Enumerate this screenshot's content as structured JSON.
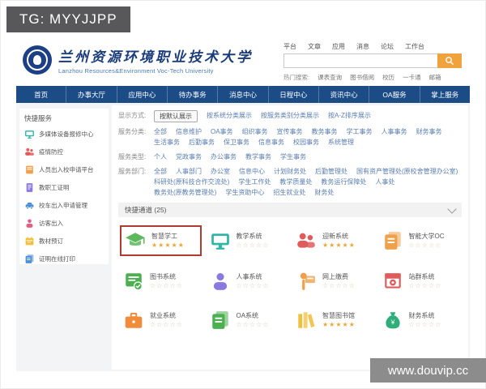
{
  "badge": {
    "text": "TG: MYYJJPP"
  },
  "watermark": {
    "text": "www.douvip.cc"
  },
  "header": {
    "university_cn": "兰州资源环境职业技术大学",
    "university_en": "Lanzhou Resources&Environment Voc-Tech University",
    "top_links": [
      "平台",
      "文章",
      "应用",
      "消息",
      "论坛",
      "工作台"
    ],
    "search": {
      "value": "",
      "placeholder": ""
    },
    "hot_links_label": "热门搜索:",
    "hot_links": [
      "课表查询",
      "图书借阅",
      "校历",
      "一卡通",
      "邮箱"
    ]
  },
  "nav": {
    "items": [
      "首页",
      "办事大厅",
      "应用中心",
      "待办事务",
      "消息中心",
      "日程中心",
      "资讯中心",
      "OA服务",
      "掌上服务"
    ]
  },
  "sidebar": {
    "title": "快捷服务",
    "items": [
      {
        "label": "多媒体设备报修中心",
        "icon": "monitor-icon",
        "color": "#2fb5a3"
      },
      {
        "label": "疫情防控",
        "icon": "people-icon",
        "color": "#e05c5c"
      },
      {
        "label": "人员出入校申请平台",
        "icon": "book-icon",
        "color": "#f0a04a"
      },
      {
        "label": "教职工证明",
        "icon": "doc-icon",
        "color": "#8a7ae0"
      },
      {
        "label": "校车出入申请管理",
        "icon": "car-icon",
        "color": "#4a90d9"
      },
      {
        "label": "访客出入",
        "icon": "person-icon",
        "color": "#e06080"
      },
      {
        "label": "教材预订",
        "icon": "calendar-icon",
        "color": "#f0c040"
      },
      {
        "label": "证明在线打印",
        "icon": "docs-icon",
        "color": "#4a90d9"
      }
    ]
  },
  "filters": [
    {
      "label": "显示方式:",
      "selected_index": 0,
      "options": [
        "按默认展示",
        "按系统分类展示",
        "按服务类别分类展示",
        "按A-Z排序展示"
      ]
    },
    {
      "label": "服务分类:",
      "selected_index": -1,
      "options": [
        "全部",
        "信息维护",
        "OA事务",
        "组织事务",
        "宣传事务",
        "教务事务",
        "学工事务",
        "人事事务",
        "财务事务",
        "生活事务",
        "后勤事务",
        "保卫事务",
        "信息事务",
        "校园事务",
        "系统管理"
      ]
    },
    {
      "label": "服务类型:",
      "selected_index": -1,
      "options": [
        "个人",
        "党政事务",
        "办公事务",
        "教学事务",
        "学生事务"
      ]
    },
    {
      "label": "服务部门:",
      "selected_index": -1,
      "options": [
        "全部",
        "人事部门",
        "办公室",
        "信息中心",
        "计划财务处",
        "后勤管理处",
        "国有资产管理处(原校舍管理办公室)",
        "科研处(原科技合作交流处)",
        "学生工作处",
        "教学质量处",
        "教务运行保障处",
        "人事处",
        "教务处(原教务管理处)",
        "学生资助中心",
        "招生就业处",
        "财务处"
      ]
    }
  ],
  "section": {
    "title": "快捷通道",
    "count": "(25)"
  },
  "apps": [
    {
      "name": "智慧学工",
      "icon": "gradcap-icon",
      "color": "#5cb85c",
      "stars": 5,
      "highlight": true
    },
    {
      "name": "教学系统",
      "icon": "monitor-icon",
      "color": "#2fb5a3",
      "stars": 0
    },
    {
      "name": "迎新系统",
      "icon": "people-icon",
      "color": "#e05c5c",
      "stars": 5
    },
    {
      "name": "智能大学OC",
      "icon": "docs-icon",
      "color": "#f0a04a",
      "stars": 0
    },
    {
      "name": "图书系统",
      "icon": "cardcheck-icon",
      "color": "#4caf50",
      "stars": 0
    },
    {
      "name": "人事系统",
      "icon": "person-icon",
      "color": "#8a7ae0",
      "stars": 0
    },
    {
      "name": "网上缴费",
      "icon": "personflag-icon",
      "color": "#f0a04a",
      "stars": 0
    },
    {
      "name": "站群系统",
      "icon": "browsergear-icon",
      "color": "#e05c5c",
      "stars": 0
    },
    {
      "name": "就业系统",
      "icon": "briefcase-icon",
      "color": "#f08c3a",
      "stars": 0
    },
    {
      "name": "OA系统",
      "icon": "docs-icon",
      "color": "#4caf50",
      "stars": 0
    },
    {
      "name": "智慧图书馆",
      "icon": "books-icon",
      "color": "#f0c040",
      "stars": 5
    },
    {
      "name": "财务系统",
      "icon": "moneybag-icon",
      "color": "#2fae7a",
      "stars": 0
    }
  ],
  "colors": {
    "nav_bg": "#1b4c86",
    "search_button": "#f0a23c",
    "highlight_border": "#b03a2e",
    "star_on": "#e6a93c"
  }
}
